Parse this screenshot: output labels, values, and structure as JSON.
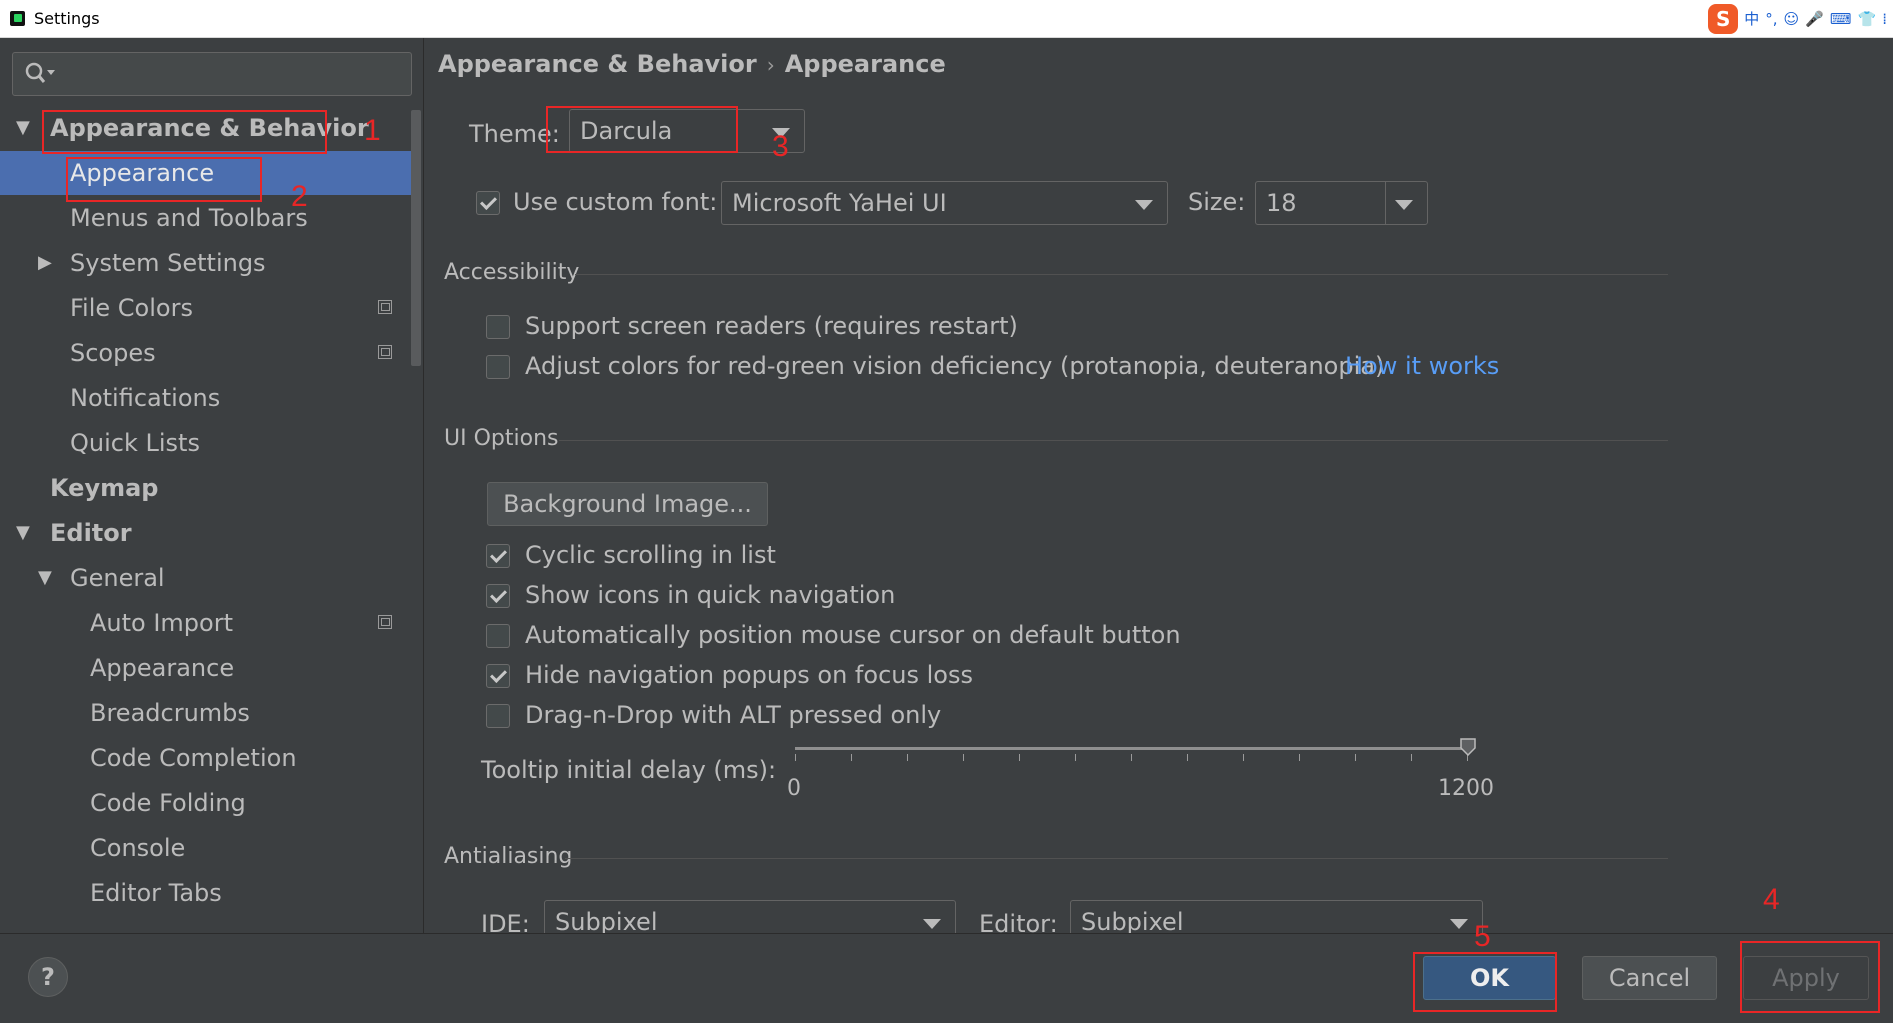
{
  "window": {
    "title": "Settings"
  },
  "tray": {
    "items": [
      "S",
      "中",
      "°,",
      "☺",
      "🎤",
      "⌨",
      "👕",
      "⁞"
    ]
  },
  "search": {
    "placeholder": ""
  },
  "sidebar": {
    "items": [
      {
        "label": "Appearance & Behavior",
        "expanded": true
      },
      {
        "label": "Appearance",
        "selected": true
      },
      {
        "label": "Menus and Toolbars"
      },
      {
        "label": "System Settings",
        "expanded": false
      },
      {
        "label": "File Colors"
      },
      {
        "label": "Scopes"
      },
      {
        "label": "Notifications"
      },
      {
        "label": "Quick Lists"
      },
      {
        "label": "Keymap"
      },
      {
        "label": "Editor",
        "expanded": true
      },
      {
        "label": "General",
        "expanded": true
      },
      {
        "label": "Auto Import"
      },
      {
        "label": "Appearance"
      },
      {
        "label": "Breadcrumbs"
      },
      {
        "label": "Code Completion"
      },
      {
        "label": "Code Folding"
      },
      {
        "label": "Console"
      },
      {
        "label": "Editor Tabs"
      }
    ]
  },
  "breadcrumb": {
    "parent": "Appearance & Behavior",
    "sep": "›",
    "current": "Appearance"
  },
  "theme": {
    "label": "Theme:",
    "value": "Darcula"
  },
  "font": {
    "label": "Use custom font:",
    "checked": true,
    "value": "Microsoft YaHei UI",
    "size_label": "Size:",
    "size_value": "18"
  },
  "accessibility": {
    "header": "Accessibility",
    "screen_readers": {
      "label": "Support screen readers (requires restart)",
      "checked": false
    },
    "color_adjust": {
      "label": "Adjust colors for red-green vision deficiency (protanopia, deuteranopia)",
      "checked": false
    },
    "how_it_works": "How it works"
  },
  "ui_options": {
    "header": "UI Options",
    "background_button": "Background Image...",
    "checkboxes": [
      {
        "label": "Cyclic scrolling in list",
        "checked": true
      },
      {
        "label": "Show icons in quick navigation",
        "checked": true
      },
      {
        "label": "Automatically position mouse cursor on default button",
        "checked": false
      },
      {
        "label": "Hide navigation popups on focus loss",
        "checked": true
      },
      {
        "label": "Drag-n-Drop with ALT pressed only",
        "checked": false
      }
    ],
    "tooltip": {
      "label": "Tooltip initial delay (ms):",
      "min": "0",
      "max": "1200",
      "value": 1200
    }
  },
  "antialiasing": {
    "header": "Antialiasing",
    "ide_label": "IDE:",
    "ide_value": "Subpixel",
    "editor_label": "Editor:",
    "editor_value": "Subpixel"
  },
  "footer": {
    "help": "?",
    "ok": "OK",
    "cancel": "Cancel",
    "apply": "Apply"
  },
  "annotations": [
    "1",
    "2",
    "3",
    "4",
    "5"
  ],
  "colors": {
    "accent": "#4b6eaf",
    "background": "#3c3f41",
    "annotation": "#e82626",
    "link": "#589df6"
  }
}
